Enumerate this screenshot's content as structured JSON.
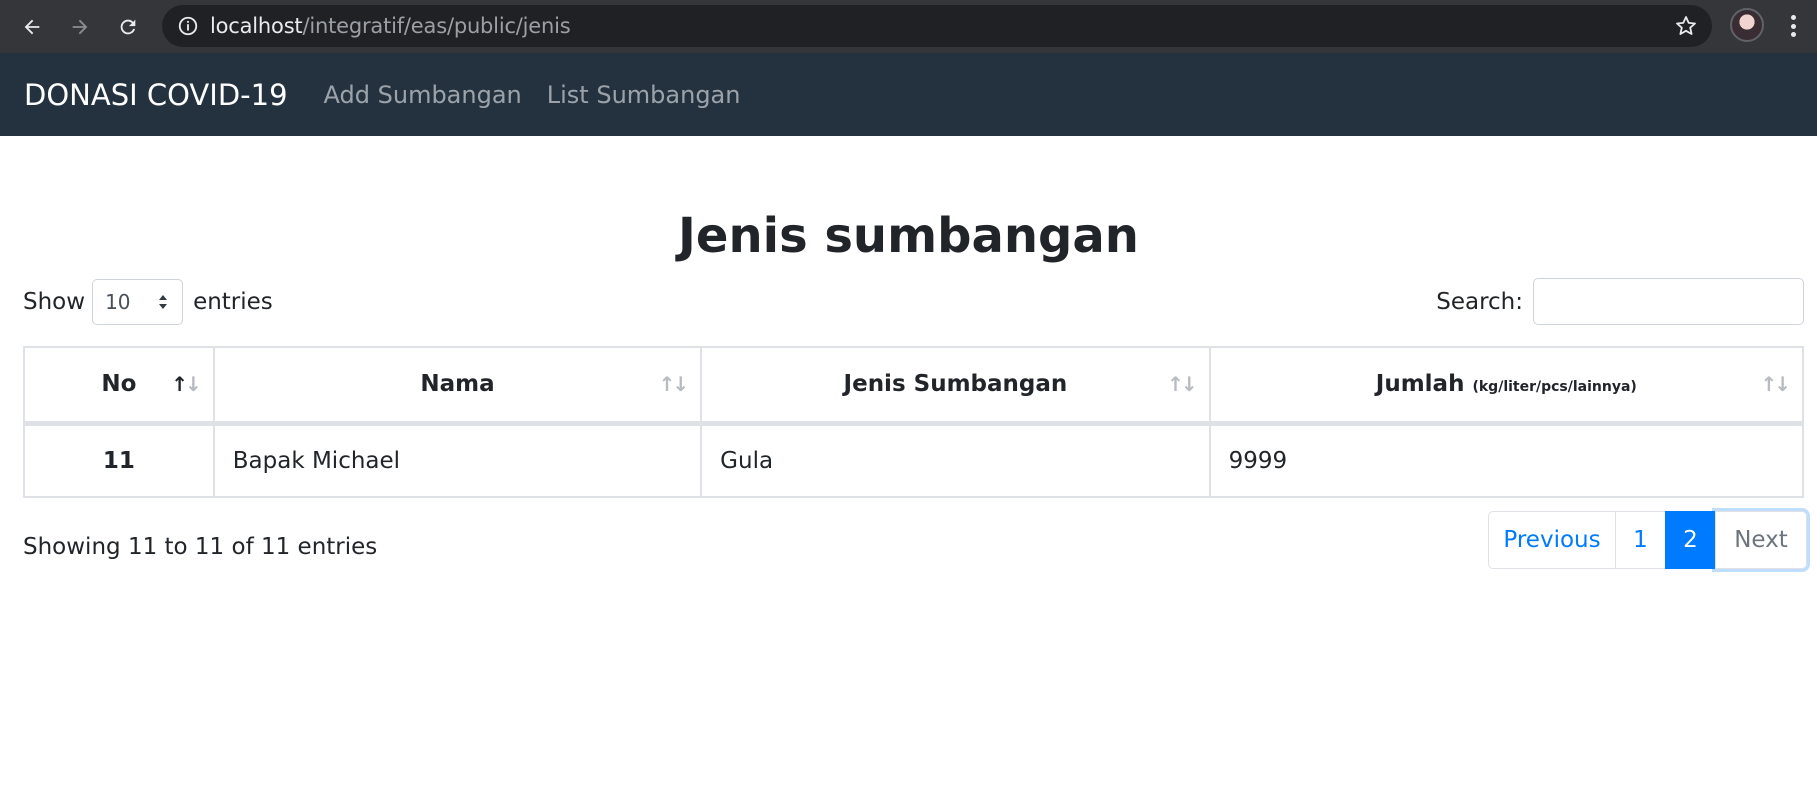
{
  "browser": {
    "url_host": "localhost",
    "url_path": "/integratif/eas/public/jenis"
  },
  "navbar": {
    "brand": "DONASI COVID-19",
    "links": [
      "Add Sumbangan",
      "List Sumbangan"
    ]
  },
  "page": {
    "title": "Jenis sumbangan"
  },
  "length": {
    "show_label": "Show",
    "value": "10",
    "entries_label": "entries"
  },
  "search": {
    "label": "Search:",
    "value": ""
  },
  "table": {
    "headers": {
      "no": "No",
      "nama": "Nama",
      "jenis": "Jenis Sumbangan",
      "jumlah": "Jumlah",
      "jumlah_unit": "(kg/liter/pcs/lainnya)"
    },
    "rows": [
      {
        "no": "11",
        "nama": "Bapak Michael",
        "jenis": "Gula",
        "jumlah": "9999"
      }
    ]
  },
  "info": "Showing 11 to 11 of 11 entries",
  "pagination": {
    "previous": "Previous",
    "pages": [
      "1",
      "2"
    ],
    "current_page": "2",
    "next": "Next"
  }
}
